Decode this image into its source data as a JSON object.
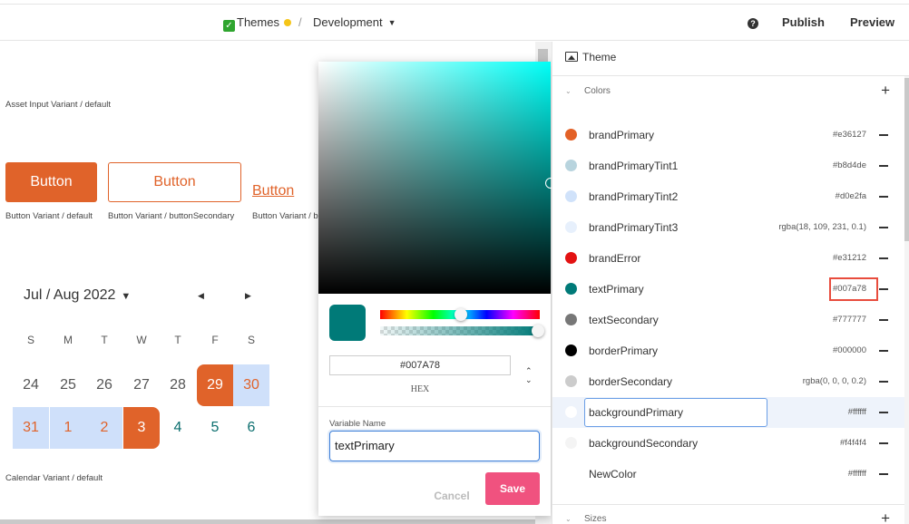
{
  "topbar": {
    "themes_label": "Themes",
    "separator": "/",
    "branch_label": "Development",
    "help_icon": "?",
    "publish_label": "Publish",
    "preview_label": "Preview",
    "check_icon": "✓"
  },
  "canvas": {
    "asset_input_label": "Asset Input Variant / default",
    "button_primary_label": "Button",
    "button_secondary_label": "Button",
    "button_link_label": "Button",
    "button_variant_default": "Button Variant / default",
    "button_variant_secondary": "Button Variant / buttonSecondary",
    "button_variant_link": "Button Variant / b",
    "calendar": {
      "title": "Jul / Aug 2022",
      "caret": "▼",
      "prev": "◀",
      "next": "▶",
      "weekdays": [
        "S",
        "M",
        "T",
        "W",
        "T",
        "F",
        "S"
      ],
      "week1": [
        "24",
        "25",
        "26",
        "27",
        "28",
        "29",
        "30"
      ],
      "week2": [
        "31",
        "1",
        "2",
        "3",
        "4",
        "5",
        "6"
      ]
    },
    "calendar_variant_label": "Calendar Variant / default"
  },
  "picker": {
    "hex_value": "#007A78",
    "hex_label": "HEX",
    "toggle_up": "⌃",
    "toggle_down": "⌄",
    "variable_name_label": "Variable Name",
    "variable_name_value": "textPrimary",
    "cancel_label": "Cancel",
    "save_label": "Save",
    "current_color": "#007a78"
  },
  "panel": {
    "title": "Theme",
    "colors_section": "Colors",
    "sizes_section": "Sizes",
    "add_icon": "+",
    "chevron_icon": "⌄",
    "colors": [
      {
        "name": "brandPrimary",
        "value": "#e36127",
        "swatch": "#e36127"
      },
      {
        "name": "brandPrimaryTint1",
        "value": "#b8d4de",
        "swatch": "#b8d4de"
      },
      {
        "name": "brandPrimaryTint2",
        "value": "#d0e2fa",
        "swatch": "#d0e2fa"
      },
      {
        "name": "brandPrimaryTint3",
        "value": "rgba(18, 109, 231, 0.1)",
        "swatch": "#e7f0fc"
      },
      {
        "name": "brandError",
        "value": "#e31212",
        "swatch": "#e31212"
      },
      {
        "name": "textPrimary",
        "value": "#007a78",
        "swatch": "#007a78"
      },
      {
        "name": "textSecondary",
        "value": "#777777",
        "swatch": "#777777"
      },
      {
        "name": "borderPrimary",
        "value": "#000000",
        "swatch": "#000000"
      },
      {
        "name": "borderSecondary",
        "value": "rgba(0, 0, 0, 0.2)",
        "swatch": "#cccccc"
      },
      {
        "name": "backgroundPrimary",
        "value": "#ffffff",
        "swatch": "#ffffff"
      },
      {
        "name": "backgroundSecondary",
        "value": "#f4f4f4",
        "swatch": "#f4f4f4"
      },
      {
        "name": "NewColor",
        "value": "#ffffff",
        "swatch": "#ffffff"
      }
    ]
  },
  "colors": {
    "accent": "#e0632a",
    "range_bg": "#cfe0fa",
    "save_bg": "#f0527f",
    "focus_border": "#3b7dd8",
    "highlight_box": "#e84c3d"
  }
}
